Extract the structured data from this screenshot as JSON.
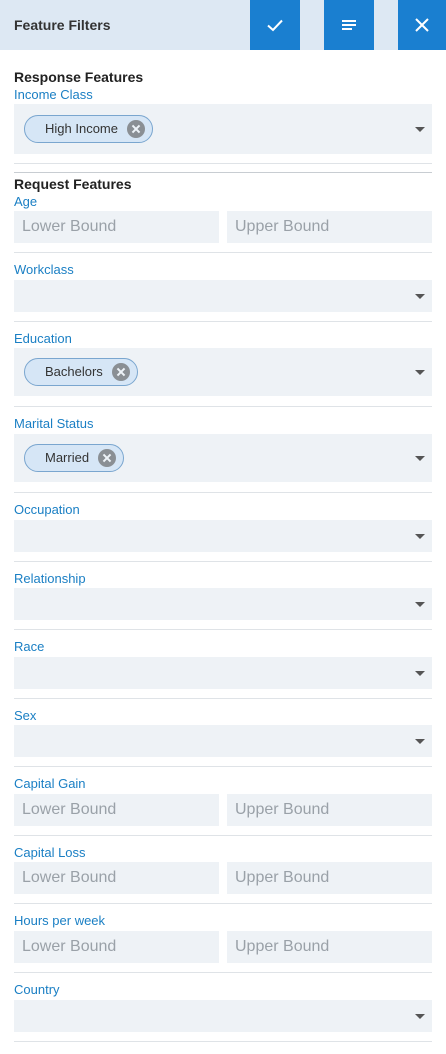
{
  "header": {
    "title": "Feature Filters",
    "apply_icon": "check-icon",
    "sort_icon": "sort-lines-icon",
    "close_icon": "close-icon",
    "accent_color": "#1a7fd0"
  },
  "response_section": {
    "title": "Response Features",
    "fields": [
      {
        "label": "Income Class",
        "type": "select",
        "chips": [
          "High Income"
        ]
      }
    ]
  },
  "request_section": {
    "title": "Request Features",
    "fields": [
      {
        "label": "Age",
        "type": "range",
        "lower_placeholder": "Lower Bound",
        "upper_placeholder": "Upper Bound"
      },
      {
        "label": "Workclass",
        "type": "select",
        "chips": []
      },
      {
        "label": "Education",
        "type": "select",
        "chips": [
          "Bachelors"
        ]
      },
      {
        "label": "Marital Status",
        "type": "select",
        "chips": [
          "Married"
        ]
      },
      {
        "label": "Occupation",
        "type": "select",
        "chips": []
      },
      {
        "label": "Relationship",
        "type": "select",
        "chips": []
      },
      {
        "label": "Race",
        "type": "select",
        "chips": []
      },
      {
        "label": "Sex",
        "type": "select",
        "chips": []
      },
      {
        "label": "Capital Gain",
        "type": "range",
        "lower_placeholder": "Lower Bound",
        "upper_placeholder": "Upper Bound"
      },
      {
        "label": "Capital Loss",
        "type": "range",
        "lower_placeholder": "Lower Bound",
        "upper_placeholder": "Upper Bound"
      },
      {
        "label": "Hours per week",
        "type": "range",
        "lower_placeholder": "Lower Bound",
        "upper_placeholder": "Upper Bound"
      },
      {
        "label": "Country",
        "type": "select",
        "chips": []
      }
    ]
  }
}
